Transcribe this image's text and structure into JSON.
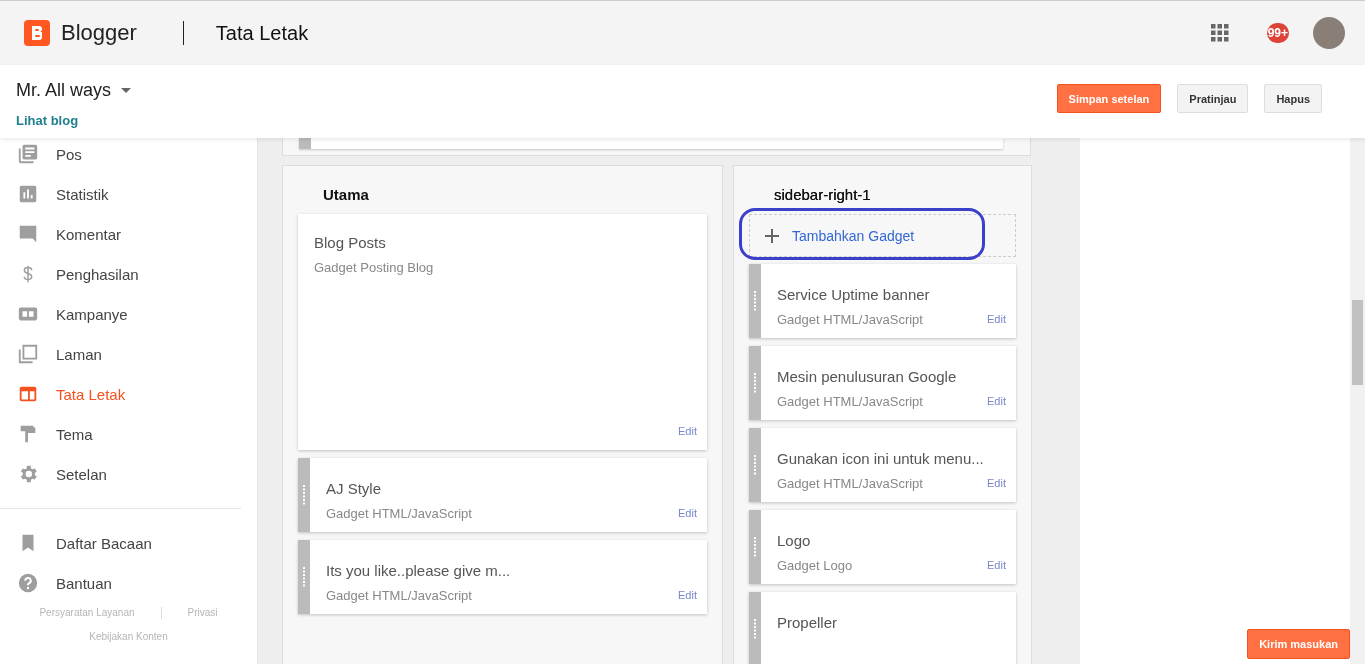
{
  "topbar": {
    "app_name": "Blogger",
    "page_title": "Tata Letak",
    "notification_count": "99+"
  },
  "blog": {
    "name": "Mr. All ways",
    "view_link": "Lihat blog"
  },
  "actions": [
    {
      "label": "Simpan setelan",
      "kind": "primary"
    },
    {
      "label": "Pratinjau",
      "kind": "secondary"
    },
    {
      "label": "Hapus",
      "kind": "secondary"
    }
  ],
  "nav": [
    {
      "label": "Pos",
      "selected": false
    },
    {
      "label": "Statistik",
      "selected": false
    },
    {
      "label": "Komentar",
      "selected": false
    },
    {
      "label": "Penghasilan",
      "selected": false
    },
    {
      "label": "Kampanye",
      "selected": false
    },
    {
      "label": "Laman",
      "selected": false
    },
    {
      "label": "Tata Letak",
      "selected": true
    },
    {
      "label": "Tema",
      "selected": false
    },
    {
      "label": "Setelan",
      "selected": false
    }
  ],
  "nav_secondary": [
    {
      "label": "Daftar Bacaan",
      "selected": false
    },
    {
      "label": "Bantuan",
      "selected": false
    }
  ],
  "footer_links": [
    "Persyaratan Layanan",
    "Privasi",
    "Kebijakan Konten"
  ],
  "sections": [
    {
      "title": "Utama",
      "gadgets": [
        {
          "title": "Blog Posts",
          "type": "Gadget Posting Blog",
          "edit": "Edit",
          "kind": "fixed"
        },
        {
          "title": "AJ Style",
          "type": "Gadget HTML/JavaScript",
          "edit": "Edit",
          "kind": "movable"
        },
        {
          "title": "Its you like..please give m...",
          "type": "Gadget HTML/JavaScript",
          "edit": "Edit",
          "kind": "movable"
        }
      ]
    },
    {
      "title": "sidebar-right-1",
      "add_gadget": "Tambahkan Gadget",
      "gadgets": [
        {
          "title": "Service Uptime banner",
          "type": "Gadget HTML/JavaScript",
          "edit": "Edit",
          "kind": "movable"
        },
        {
          "title": "Mesin penulusuran Google",
          "type": "Gadget HTML/JavaScript",
          "edit": "Edit",
          "kind": "movable"
        },
        {
          "title": "Gunakan icon ini untuk menu...",
          "type": "Gadget HTML/JavaScript",
          "edit": "Edit",
          "kind": "movable"
        },
        {
          "title": "Logo",
          "type": "Gadget Logo",
          "edit": "Edit",
          "kind": "movable"
        },
        {
          "title": "Propeller",
          "kind": "partial"
        }
      ]
    }
  ],
  "feedback_button": "Kirim masukan"
}
